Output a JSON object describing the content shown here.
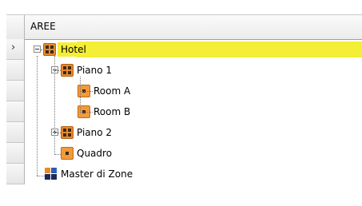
{
  "header": {
    "title": "AREE"
  },
  "tree": [
    {
      "label": "Hotel",
      "icon": "grid-orange-icon",
      "level": 0,
      "expander": "minus",
      "selected": true
    },
    {
      "label": "Piano 1",
      "icon": "grid-orange-icon",
      "level": 1,
      "expander": "minus"
    },
    {
      "label": "Room A",
      "icon": "room-orange-icon",
      "level": 2
    },
    {
      "label": "Room B",
      "icon": "room-orange-icon",
      "level": 2
    },
    {
      "label": "Piano 2",
      "icon": "grid-orange-icon",
      "level": 1,
      "expander": "plus"
    },
    {
      "label": "Quadro",
      "icon": "room-orange-icon",
      "level": 1
    },
    {
      "label": "Master di Zone",
      "icon": "master-zone-icon",
      "level": 0
    }
  ],
  "colors": {
    "selection": "#f5ee36",
    "icon_orange": "#e88a2c"
  }
}
